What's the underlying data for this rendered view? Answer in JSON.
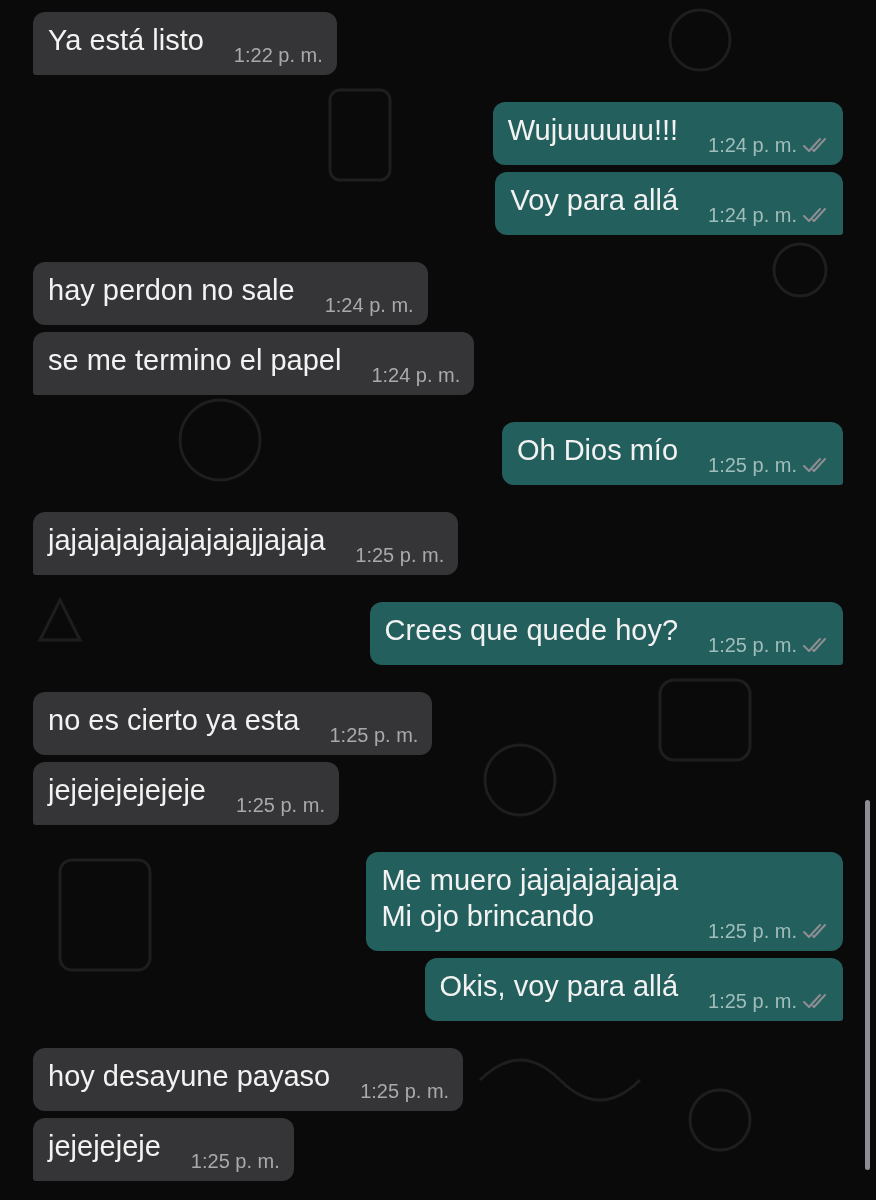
{
  "messages": [
    {
      "kind": "in",
      "text": "Ya está listo",
      "time": "1:22 p. m.",
      "tail": true
    },
    {
      "kind": "out",
      "text": "Wujuuuuuu!!!",
      "time": "1:24 p. m.",
      "read": false,
      "tail": false
    },
    {
      "kind": "out",
      "text": "Voy para allá",
      "time": "1:24 p. m.",
      "read": false,
      "tail": true
    },
    {
      "kind": "in",
      "text": "hay perdon no sale",
      "time": "1:24 p. m.",
      "tail": false
    },
    {
      "kind": "in",
      "text": "se me termino el papel",
      "time": "1:24 p. m.",
      "tail": true
    },
    {
      "kind": "out",
      "text": "Oh Dios mío",
      "time": "1:25 p. m.",
      "read": false,
      "tail": true
    },
    {
      "kind": "in",
      "text": "jajajajajajajajajajjajaja",
      "time": "1:25 p. m.",
      "tail": true
    },
    {
      "kind": "out",
      "text": "Crees que quede hoy?",
      "time": "1:25 p. m.",
      "read": false,
      "tail": true
    },
    {
      "kind": "in",
      "text": "no es cierto ya esta",
      "time": "1:25 p. m.",
      "tail": false
    },
    {
      "kind": "in",
      "text": "jejejejejejeje",
      "time": "1:25 p. m.",
      "tail": true
    },
    {
      "kind": "out",
      "text": "Me muero jajajajajajaja\nMi ojo brincando",
      "time": "1:25 p. m.",
      "read": false,
      "tail": false
    },
    {
      "kind": "out",
      "text": "Okis, voy para allá",
      "time": "1:25 p. m.",
      "read": false,
      "tail": true
    },
    {
      "kind": "in",
      "text": "hoy desayune payaso",
      "time": "1:25 p. m.",
      "tail": false
    },
    {
      "kind": "in",
      "text": "jejejejeje",
      "time": "1:25 p. m.",
      "tail": true
    }
  ]
}
